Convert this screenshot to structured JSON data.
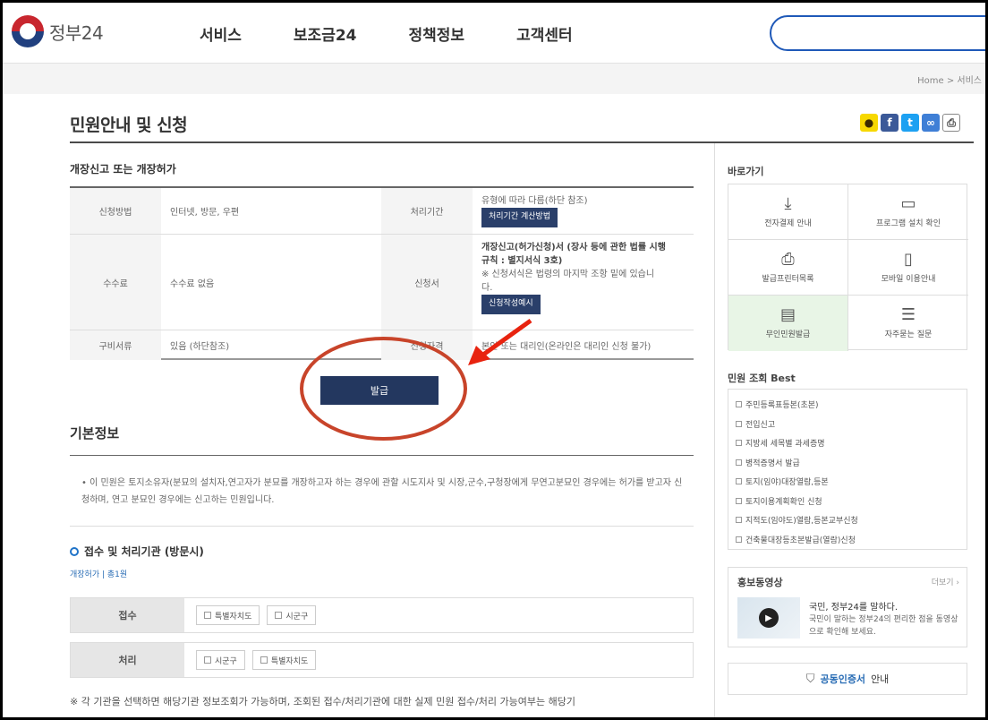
{
  "header": {
    "logo_text": "정부24",
    "nav": [
      "서비스",
      "보조금24",
      "정책정보",
      "고객센터"
    ],
    "breadcrumb": "Home > 서비스"
  },
  "page": {
    "title": "민원안내 및 신청",
    "section_title": "개장신고 또는 개장허가"
  },
  "share_icons": [
    "kakao-icon",
    "facebook-icon",
    "twitter-icon",
    "link-icon",
    "print-icon"
  ],
  "info_table": {
    "method_label": "신청방법",
    "method_value": "인터넷, 방문, 우편",
    "period_label": "처리기간",
    "period_value": "유형에 따라 다름(하단 참조)",
    "period_button": "처리기간 계산방법",
    "fee_label": "수수료",
    "fee_value": "수수료 없음",
    "form_label": "신청서",
    "form_line1": "개장신고(허가신청)서 (장사 등에 관한 법률 시행",
    "form_line2": "규칙 : 별지서식 3호)",
    "form_line3": "※ 신청서식은 법령의 마지막 조항 밑에 있습니",
    "form_line4": "다.",
    "form_button": "신청작성예시",
    "docs_label": "구비서류",
    "docs_value": "있음 (하단참조)",
    "eligibility_label": "신청자격",
    "eligibility_value": "본인 또는 대리인(온라인은 대리인 신청 불가)"
  },
  "issue_button": "발급",
  "basic": {
    "title": "기본정보",
    "desc": "이 민원은 토지소유자(분묘의 설치자,연고자가 분묘를 개장하고자 하는 경우에 관할 시도지사 및 시장,군수,구청장에게 무연고분묘인 경우에는 허가를 받고자 신청하며, 연고 분묘인 경우에는 신고하는 민원입니다."
  },
  "processing": {
    "title": "접수 및 처리기관 (방문시)",
    "link": "개장허가 | 총1원",
    "receive_label": "접수",
    "receive_chips": [
      "특별자치도",
      "시군구"
    ],
    "process_label": "처리",
    "process_chips": [
      "시군구",
      "특별자치도"
    ],
    "note": "※ 각 기관을 선택하면 해당기관 정보조회가 가능하며, 조회된 접수/처리기관에 대한 실제 민원 접수/처리 가능여부는 해당기"
  },
  "sidebar": {
    "quick_title": "바로가기",
    "quick_items": [
      {
        "label": "전자결제 안내",
        "icon": "download-icon"
      },
      {
        "label": "프로그램 설치 확인",
        "icon": "monitor-icon"
      },
      {
        "label": "발급프린터목록",
        "icon": "printer-icon"
      },
      {
        "label": "모바일 이용안내",
        "icon": "mobile-icon"
      },
      {
        "label": "무인민원발급",
        "icon": "kiosk-icon"
      },
      {
        "label": "자주묻는 질문",
        "icon": "faq-icon"
      }
    ],
    "best_title": "민원 조회 Best",
    "best_items": [
      "주민등록표등본(초본)",
      "전입신고",
      "지방세 세목별 과세증명",
      "병적증명서 발급",
      "토지(임야)대장열람,등본",
      "토지이용계획확인 신청",
      "지적도(임야도)열람,등본교부신청",
      "건축물대장등초본발급(열람)신청"
    ],
    "promo_title": "홍보동영상",
    "promo_more": "더보기 ›",
    "promo_line1": "국민, 정부24를 말하다.",
    "promo_line2": "국민이 말하는 정부24의 편리한 점을 동영상으로 확인해 보세요.",
    "cert_highlight": "공동인증서",
    "cert_rest": "안내"
  }
}
